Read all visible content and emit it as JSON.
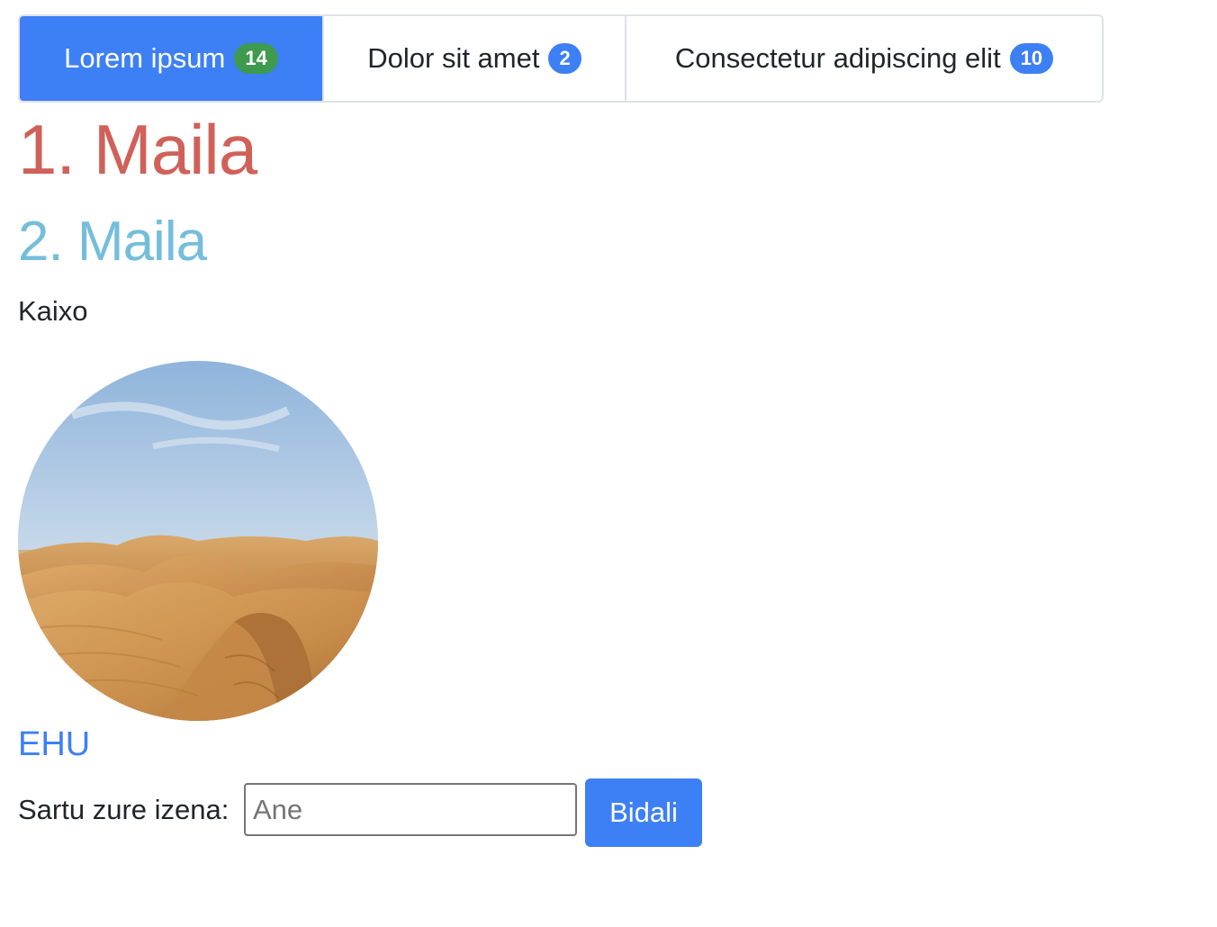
{
  "tabs": [
    {
      "label": "Lorem ipsum",
      "badge": "14"
    },
    {
      "label": "Dolor sit amet",
      "badge": "2"
    },
    {
      "label": "Consectetur adipiscing elit",
      "badge": "10"
    }
  ],
  "heading1": "1. Maila",
  "heading2": "2. Maila",
  "paragraph": "Kaixo",
  "image": {
    "subject": "desert sand dunes under a blue sky"
  },
  "link": {
    "label": "EHU"
  },
  "form": {
    "label": "Sartu zure izena:",
    "placeholder": "Ane",
    "value": "",
    "submit_label": "Bidali"
  },
  "colors": {
    "primary": "#3d7ff5",
    "success": "#3e9a4f",
    "heading1": "#d06159",
    "heading2": "#75bedb"
  }
}
